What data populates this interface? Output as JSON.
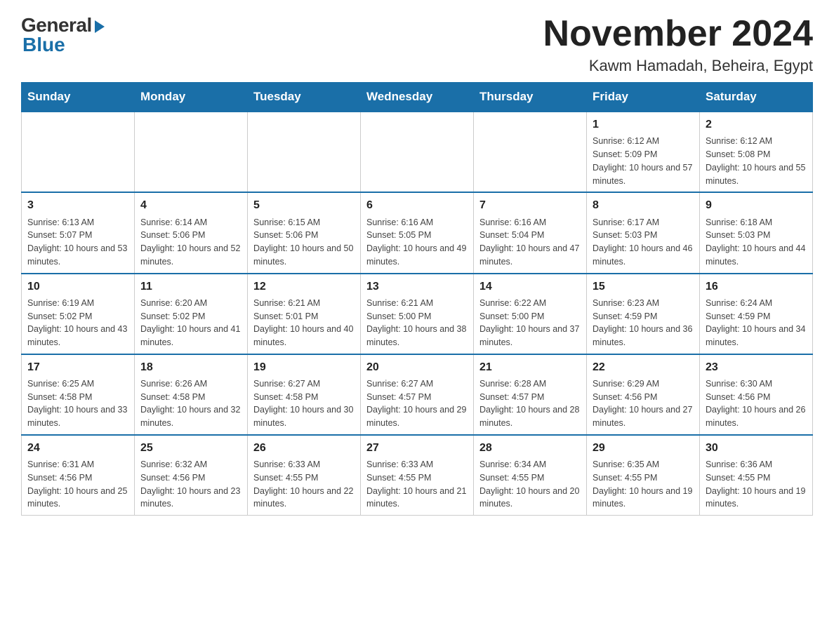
{
  "logo": {
    "general": "General",
    "blue": "Blue"
  },
  "header": {
    "title": "November 2024",
    "location": "Kawm Hamadah, Beheira, Egypt"
  },
  "weekdays": [
    "Sunday",
    "Monday",
    "Tuesday",
    "Wednesday",
    "Thursday",
    "Friday",
    "Saturday"
  ],
  "weeks": [
    [
      {
        "day": "",
        "info": ""
      },
      {
        "day": "",
        "info": ""
      },
      {
        "day": "",
        "info": ""
      },
      {
        "day": "",
        "info": ""
      },
      {
        "day": "",
        "info": ""
      },
      {
        "day": "1",
        "info": "Sunrise: 6:12 AM\nSunset: 5:09 PM\nDaylight: 10 hours and 57 minutes."
      },
      {
        "day": "2",
        "info": "Sunrise: 6:12 AM\nSunset: 5:08 PM\nDaylight: 10 hours and 55 minutes."
      }
    ],
    [
      {
        "day": "3",
        "info": "Sunrise: 6:13 AM\nSunset: 5:07 PM\nDaylight: 10 hours and 53 minutes."
      },
      {
        "day": "4",
        "info": "Sunrise: 6:14 AM\nSunset: 5:06 PM\nDaylight: 10 hours and 52 minutes."
      },
      {
        "day": "5",
        "info": "Sunrise: 6:15 AM\nSunset: 5:06 PM\nDaylight: 10 hours and 50 minutes."
      },
      {
        "day": "6",
        "info": "Sunrise: 6:16 AM\nSunset: 5:05 PM\nDaylight: 10 hours and 49 minutes."
      },
      {
        "day": "7",
        "info": "Sunrise: 6:16 AM\nSunset: 5:04 PM\nDaylight: 10 hours and 47 minutes."
      },
      {
        "day": "8",
        "info": "Sunrise: 6:17 AM\nSunset: 5:03 PM\nDaylight: 10 hours and 46 minutes."
      },
      {
        "day": "9",
        "info": "Sunrise: 6:18 AM\nSunset: 5:03 PM\nDaylight: 10 hours and 44 minutes."
      }
    ],
    [
      {
        "day": "10",
        "info": "Sunrise: 6:19 AM\nSunset: 5:02 PM\nDaylight: 10 hours and 43 minutes."
      },
      {
        "day": "11",
        "info": "Sunrise: 6:20 AM\nSunset: 5:02 PM\nDaylight: 10 hours and 41 minutes."
      },
      {
        "day": "12",
        "info": "Sunrise: 6:21 AM\nSunset: 5:01 PM\nDaylight: 10 hours and 40 minutes."
      },
      {
        "day": "13",
        "info": "Sunrise: 6:21 AM\nSunset: 5:00 PM\nDaylight: 10 hours and 38 minutes."
      },
      {
        "day": "14",
        "info": "Sunrise: 6:22 AM\nSunset: 5:00 PM\nDaylight: 10 hours and 37 minutes."
      },
      {
        "day": "15",
        "info": "Sunrise: 6:23 AM\nSunset: 4:59 PM\nDaylight: 10 hours and 36 minutes."
      },
      {
        "day": "16",
        "info": "Sunrise: 6:24 AM\nSunset: 4:59 PM\nDaylight: 10 hours and 34 minutes."
      }
    ],
    [
      {
        "day": "17",
        "info": "Sunrise: 6:25 AM\nSunset: 4:58 PM\nDaylight: 10 hours and 33 minutes."
      },
      {
        "day": "18",
        "info": "Sunrise: 6:26 AM\nSunset: 4:58 PM\nDaylight: 10 hours and 32 minutes."
      },
      {
        "day": "19",
        "info": "Sunrise: 6:27 AM\nSunset: 4:58 PM\nDaylight: 10 hours and 30 minutes."
      },
      {
        "day": "20",
        "info": "Sunrise: 6:27 AM\nSunset: 4:57 PM\nDaylight: 10 hours and 29 minutes."
      },
      {
        "day": "21",
        "info": "Sunrise: 6:28 AM\nSunset: 4:57 PM\nDaylight: 10 hours and 28 minutes."
      },
      {
        "day": "22",
        "info": "Sunrise: 6:29 AM\nSunset: 4:56 PM\nDaylight: 10 hours and 27 minutes."
      },
      {
        "day": "23",
        "info": "Sunrise: 6:30 AM\nSunset: 4:56 PM\nDaylight: 10 hours and 26 minutes."
      }
    ],
    [
      {
        "day": "24",
        "info": "Sunrise: 6:31 AM\nSunset: 4:56 PM\nDaylight: 10 hours and 25 minutes."
      },
      {
        "day": "25",
        "info": "Sunrise: 6:32 AM\nSunset: 4:56 PM\nDaylight: 10 hours and 23 minutes."
      },
      {
        "day": "26",
        "info": "Sunrise: 6:33 AM\nSunset: 4:55 PM\nDaylight: 10 hours and 22 minutes."
      },
      {
        "day": "27",
        "info": "Sunrise: 6:33 AM\nSunset: 4:55 PM\nDaylight: 10 hours and 21 minutes."
      },
      {
        "day": "28",
        "info": "Sunrise: 6:34 AM\nSunset: 4:55 PM\nDaylight: 10 hours and 20 minutes."
      },
      {
        "day": "29",
        "info": "Sunrise: 6:35 AM\nSunset: 4:55 PM\nDaylight: 10 hours and 19 minutes."
      },
      {
        "day": "30",
        "info": "Sunrise: 6:36 AM\nSunset: 4:55 PM\nDaylight: 10 hours and 19 minutes."
      }
    ]
  ]
}
